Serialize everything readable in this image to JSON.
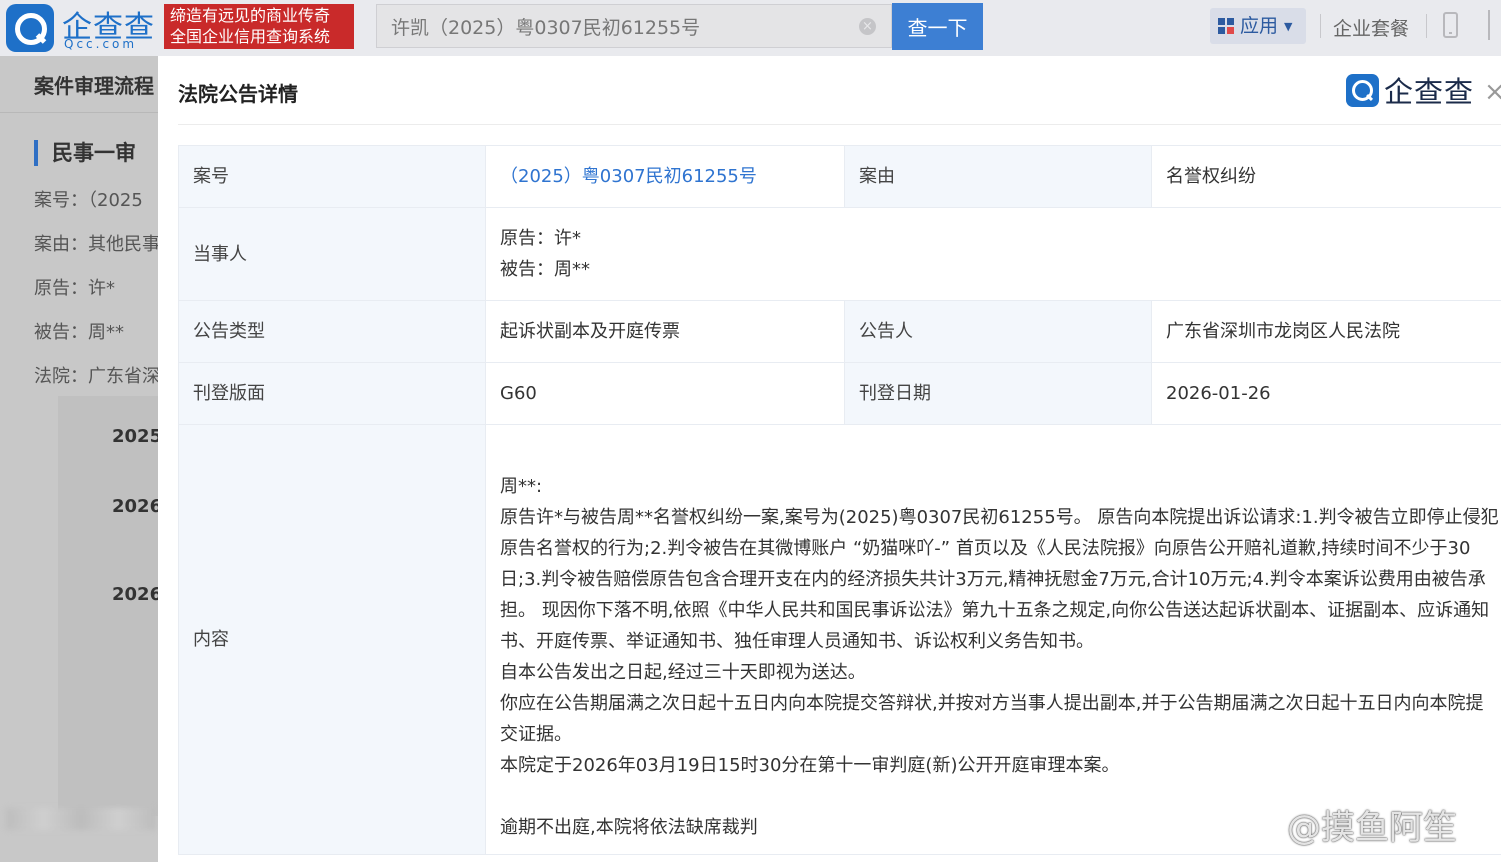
{
  "header": {
    "logo_text": "企查查",
    "logo_sub": "Qcc.com",
    "slogan_line1": "缔造有远见的商业传奇",
    "slogan_line2": "全国企业信用查询系统",
    "search_value": "许凯（2025）粤0307民初61255号",
    "search_button": "查一下",
    "apps_label": "应用",
    "enterprise_label": "企业套餐"
  },
  "background_page": {
    "section_title": "案件审理流程",
    "sub_title": "民事一审",
    "lines": [
      "案号：（2025",
      "案由：其他民事",
      "原告：许*",
      "被告：周**",
      "法院：广东省深"
    ],
    "dates": [
      "2025-",
      "2026-",
      "2026-"
    ]
  },
  "modal": {
    "title": "法院公告详情",
    "logo_text": "企查查",
    "close": "×",
    "rows": {
      "case_no_label": "案号",
      "case_no_value": "（2025）粤0307民初61255号",
      "cause_label": "案由",
      "cause_value": "名誉权纠纷",
      "party_label": "当事人",
      "plaintiff": "原告：许*",
      "defendant": "被告：周**",
      "notice_type_label": "公告类型",
      "notice_type_value": "起诉状副本及开庭传票",
      "announcer_label": "公告人",
      "announcer_value": "广东省深圳市龙岗区人民法院",
      "page_label": "刊登版面",
      "page_value": "G60",
      "date_label": "刊登日期",
      "date_value": "2026-01-26",
      "content_label": "内容",
      "content_paragraphs": [
        "周**:",
        "原告许*与被告周**名誉权纠纷一案,案号为(2025)粤0307民初61255号。 原告向本院提出诉讼请求:1.判令被告立即停止侵犯原告名誉权的行为;2.判令被告在其微博账户 “奶猫咪吖-” 首页以及《人民法院报》向原告公开赔礼道歉,持续时间不少于30日;3.判令被告赔偿原告包含合理开支在内的经济损失共计3万元,精神抚慰金7万元,合计10万元;4.判令本案诉讼费用由被告承担。 现因你下落不明,依照《中华人民共和国民事诉讼法》第九十五条之规定,向你公告送达起诉状副本、证据副本、应诉通知书、开庭传票、举证通知书、独任审理人员通知书、诉讼权利义务告知书。",
        "自本公告发出之日起,经过三十天即视为送达。",
        "你应在公告期届满之次日起十五日内向本院提交答辩状,并按对方当事人提出副本,并于公告期届满之次日起十五日内向本院提交证据。",
        "本院定于2026年03月19日15时30分在第十一审判庭(新)公开开庭审理本案。"
      ],
      "content_final": "逾期不出庭,本院将依法缺席裁判"
    }
  },
  "watermark": "@摸鱼阿笙"
}
